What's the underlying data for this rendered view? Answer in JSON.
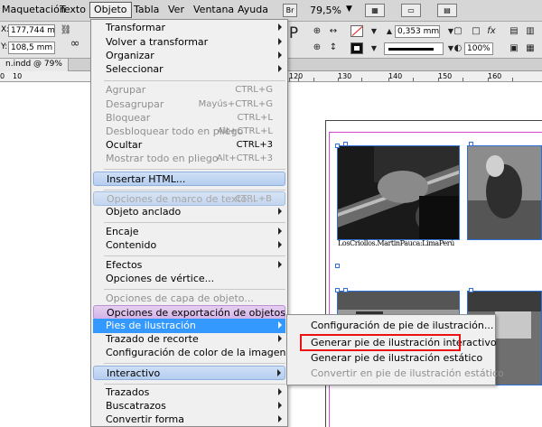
{
  "menubar": {
    "items": [
      "Maquetación",
      "Texto",
      "Objeto",
      "Tabla",
      "Ver",
      "Ventana",
      "Ayuda"
    ],
    "bridge_btn": "Br",
    "zoom": "79,5%"
  },
  "control_panel": {
    "x_value": "177,744 mm",
    "y_value": "108,5 mm",
    "stroke_weight": "0,353 mm",
    "opacity": "100%"
  },
  "document_tab": {
    "label": "n.indd @ 79%"
  },
  "ruler": {
    "ticks": [
      "0",
      "10",
      "120",
      "130",
      "140",
      "150",
      "160"
    ]
  },
  "canvas": {
    "caption": "LosCriollos.MartinPauca:LimaPerú"
  },
  "object_menu": {
    "items": [
      {
        "label": "Transformar",
        "submenu": true
      },
      {
        "label": "Volver a transformar",
        "submenu": true
      },
      {
        "label": "Organizar",
        "submenu": true
      },
      {
        "label": "Seleccionar",
        "submenu": true
      },
      {
        "label": "Agrupar",
        "shortcut": "CTRL+G",
        "disabled": true
      },
      {
        "label": "Desagrupar",
        "shortcut": "Mayús+CTRL+G",
        "disabled": true
      },
      {
        "label": "Bloquear",
        "shortcut": "CTRL+L",
        "disabled": true
      },
      {
        "label": "Desbloquear todo en pliego",
        "shortcut": "Alt+CTRL+L",
        "disabled": true
      },
      {
        "label": "Ocultar",
        "shortcut": "CTRL+3"
      },
      {
        "label": "Mostrar todo en pliego",
        "shortcut": "Alt+CTRL+3",
        "disabled": true
      },
      {
        "label": "Insertar HTML..."
      },
      {
        "label": "Opciones de marco de texto...",
        "shortcut": "CTRL+B",
        "disabled": true
      },
      {
        "label": "Objeto anclado",
        "submenu": true
      },
      {
        "label": "Encaje",
        "submenu": true
      },
      {
        "label": "Contenido",
        "submenu": true
      },
      {
        "label": "Efectos",
        "submenu": true
      },
      {
        "label": "Opciones de vértice..."
      },
      {
        "label": "Opciones de capa de objeto...",
        "disabled": true
      },
      {
        "label": "Opciones de exportación de objetos..."
      },
      {
        "label": "Pies de ilustración",
        "submenu": true
      },
      {
        "label": "Trazado de recorte",
        "submenu": true
      },
      {
        "label": "Configuración de color de la imagen..."
      },
      {
        "label": "Interactivo",
        "submenu": true
      },
      {
        "label": "Trazados",
        "submenu": true
      },
      {
        "label": "Buscatrazos",
        "submenu": true
      },
      {
        "label": "Convertir forma",
        "submenu": true
      }
    ]
  },
  "captions_submenu": {
    "items": [
      {
        "label": "Configuración de pie de ilustración..."
      },
      {
        "label": "Generar pie de ilustración interactivo"
      },
      {
        "label": "Generar pie de ilustración estático"
      },
      {
        "label": "Convertir en pie de ilustración estático",
        "disabled": true
      }
    ]
  },
  "colors": {
    "selection": "#3399ff",
    "frame": "#2e6fd8",
    "margin": "#d14ad1",
    "highlight_box": "#e11111"
  }
}
